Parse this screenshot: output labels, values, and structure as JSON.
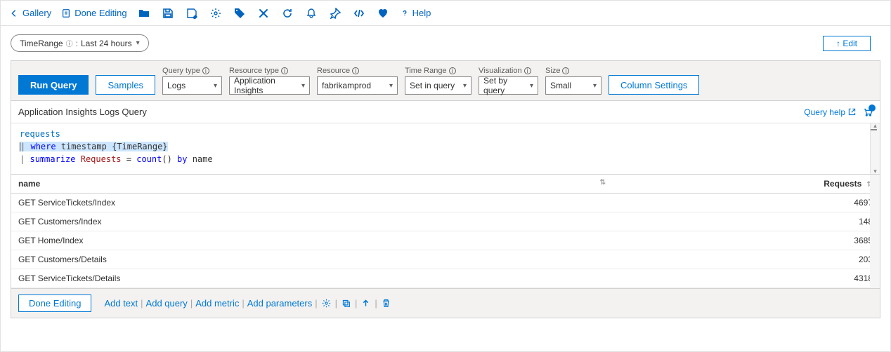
{
  "toolbar": {
    "gallery": "Gallery",
    "done_editing": "Done Editing",
    "help": "Help"
  },
  "param_pill": {
    "label": "TimeRange",
    "value": "Last 24 hours"
  },
  "edit_button": "↑ Edit",
  "query_bar": {
    "run_query": "Run Query",
    "samples": "Samples",
    "column_settings": "Column Settings",
    "controls": {
      "query_type": {
        "label": "Query type",
        "value": "Logs"
      },
      "resource_type": {
        "label": "Resource type",
        "value": "Application Insights"
      },
      "resource": {
        "label": "Resource",
        "value": "fabrikamprod"
      },
      "time_range": {
        "label": "Time Range",
        "value": "Set in query"
      },
      "visualization": {
        "label": "Visualization",
        "value": "Set by query"
      },
      "size": {
        "label": "Size",
        "value": "Small"
      }
    }
  },
  "query_title": "Application Insights Logs Query",
  "query_help": "Query help",
  "editor": {
    "line1_table": "requests",
    "line2_pipe": "|",
    "line2_where": "where",
    "line2_rest": " timestamp {TimeRange}",
    "line3_pipe": "|",
    "line3_summarize": "summarize",
    "line3_field": "Requests",
    "line3_eq": " = ",
    "line3_count": "count",
    "line3_paren": "()",
    "line3_by": "by",
    "line3_col": " name"
  },
  "table": {
    "columns": {
      "name": "name",
      "requests": "Requests"
    },
    "rows": [
      {
        "name": "GET ServiceTickets/Index",
        "requests": "4697"
      },
      {
        "name": "GET Customers/Index",
        "requests": "148"
      },
      {
        "name": "GET Home/Index",
        "requests": "3685"
      },
      {
        "name": "GET Customers/Details",
        "requests": "203"
      },
      {
        "name": "GET ServiceTickets/Details",
        "requests": "4318"
      }
    ]
  },
  "footer": {
    "done_editing": "Done Editing",
    "add_text": "Add text",
    "add_query": "Add query",
    "add_metric": "Add metric",
    "add_parameters": "Add parameters"
  }
}
